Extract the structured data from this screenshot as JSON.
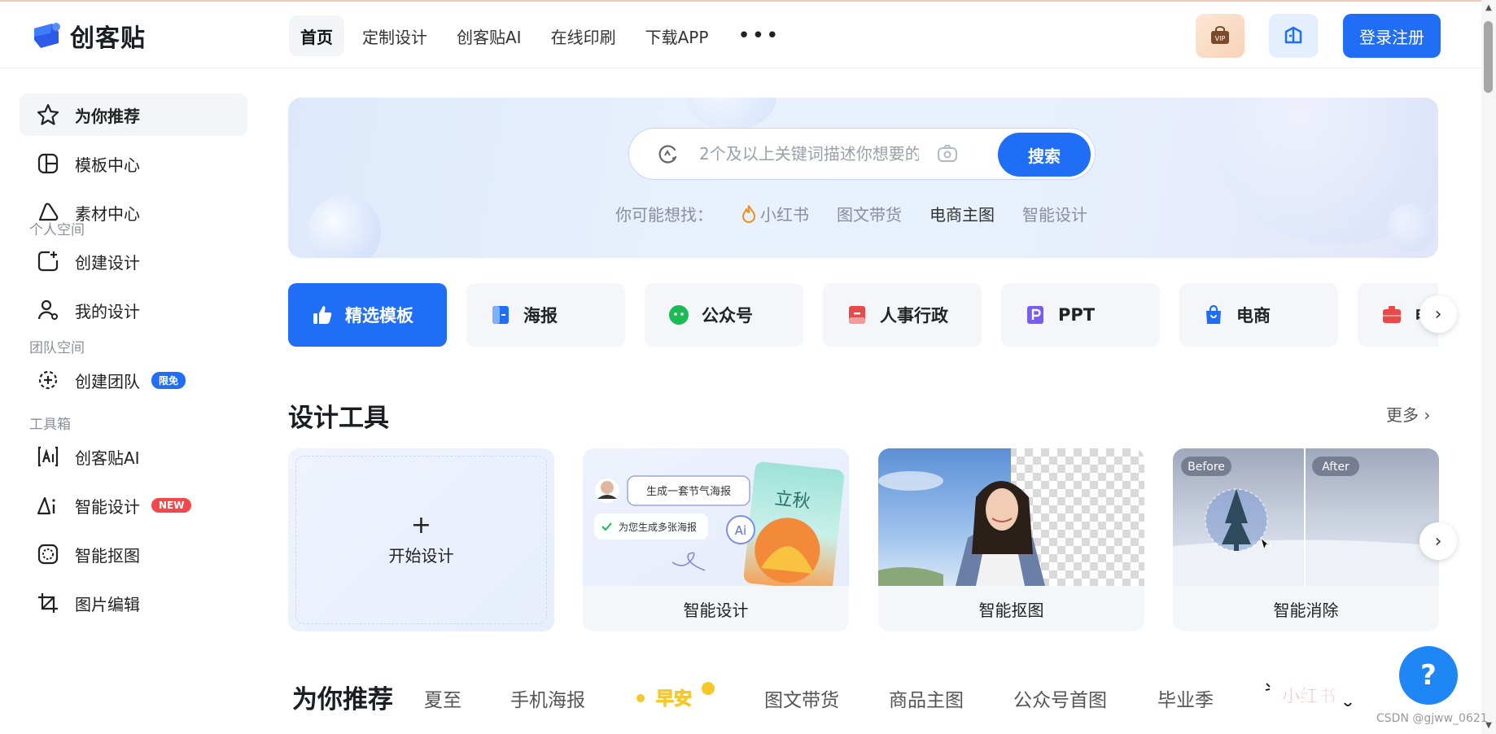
{
  "brand": {
    "name": "创客贴"
  },
  "nav": [
    {
      "label": "首页",
      "active": true
    },
    {
      "label": "定制设计"
    },
    {
      "label": "创客贴AI"
    },
    {
      "label": "在线印刷"
    },
    {
      "label": "下载APP"
    }
  ],
  "nav_more": "•••",
  "header": {
    "vip_text": "VIP",
    "login_label": "登录注册"
  },
  "sidebar": {
    "items": [
      {
        "label": "为你推荐",
        "icon": "star-icon"
      },
      {
        "label": "模板中心",
        "icon": "template-icon"
      },
      {
        "label": "素材中心",
        "icon": "material-icon"
      }
    ],
    "groups": [
      "个人空间",
      "团队空间",
      "工具箱"
    ],
    "personal": [
      {
        "label": "创建设计",
        "icon": "create-design-icon"
      },
      {
        "label": "我的设计",
        "icon": "user-icon"
      }
    ],
    "team": [
      {
        "label": "创建团队",
        "icon": "team-add-icon",
        "badge": "限免"
      }
    ],
    "tools": [
      {
        "label": "创客贴AI",
        "icon": "ai-icon"
      },
      {
        "label": "智能设计",
        "icon": "smart-design-icon",
        "badge": "NEW"
      },
      {
        "label": "智能抠图",
        "icon": "cutout-icon"
      },
      {
        "label": "图片编辑",
        "icon": "crop-icon"
      }
    ]
  },
  "search": {
    "placeholder": "2个及以上关键词描述你想要的",
    "button": "搜索",
    "suggest_label": "你可能想找：",
    "suggestions": [
      "小红书",
      "图文带货",
      "电商主图",
      "智能设计"
    ]
  },
  "categories": [
    "精选模板",
    "海报",
    "公众号",
    "人事行政",
    "PPT",
    "电商",
    "电商"
  ],
  "category_colors": [
    "#ffffff",
    "#1f6ef5",
    "#1db954",
    "#e84a4a",
    "#7b5cf0",
    "#1f6ef5",
    "#e84a4a"
  ],
  "design_tools": {
    "title": "设计工具",
    "more": "更多",
    "start": {
      "plus": "+",
      "label": "开始设计"
    },
    "cards": [
      {
        "label": "智能设计",
        "bubble1": "生成一套节气海报",
        "bubble2": "为您生成多张海报",
        "poster_text": "立秋",
        "ai_badge": "Ai"
      },
      {
        "label": "智能抠图"
      },
      {
        "label": "智能消除",
        "before": "Before",
        "after": "After"
      }
    ]
  },
  "recommend": {
    "title": "为你推荐",
    "tabs": [
      "夏至",
      "手机海报",
      "早安",
      "图文带货",
      "商品主图",
      "公众号首图",
      "毕业季",
      "小红书"
    ]
  },
  "help": "?",
  "watermark": "CSDN @gjww_0621"
}
